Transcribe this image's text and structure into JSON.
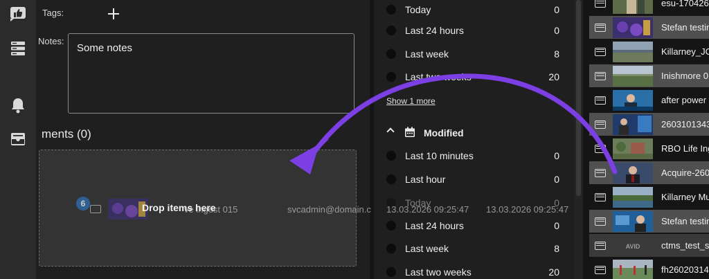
{
  "details": {
    "tags_label": "Tags:",
    "notes_label": "Notes:",
    "notes_value": "Some notes",
    "attachments_title": "ments (0)",
    "drop_label": "Drop items here"
  },
  "filters": {
    "group1": [
      {
        "label": "Today",
        "count": "0"
      },
      {
        "label": "Last 24 hours",
        "count": "0"
      },
      {
        "label": "Last week",
        "count": "8"
      },
      {
        "label": "Last two weeks",
        "count": "20"
      }
    ],
    "show_more": "Show 1 more",
    "modified_title": "Modified",
    "group2": [
      {
        "label": "Last 10 minutes",
        "count": "0"
      },
      {
        "label": "Last hour",
        "count": "0"
      },
      {
        "label": "Today",
        "count": "0"
      },
      {
        "label": "Last 24 hours",
        "count": "0"
      },
      {
        "label": "Last week",
        "count": "8"
      },
      {
        "label": "Last two weeks",
        "count": "20"
      }
    ]
  },
  "assets": [
    {
      "name": "esu-170426"
    },
    {
      "name": "Stefan testin"
    },
    {
      "name": "Killarney_JC"
    },
    {
      "name": "Inishmore 0"
    },
    {
      "name": "after power"
    },
    {
      "name": "2603101343"
    },
    {
      "name": "RBO Life Ing"
    },
    {
      "name": "Acquire-260"
    },
    {
      "name": "Killarney Mu"
    },
    {
      "name": "Stefan testin"
    },
    {
      "name": "ctms_test_s"
    },
    {
      "name": "fh26020314"
    }
  ],
  "ghost": {
    "count": "6",
    "name": "ve ingest 015",
    "user": "svcadmin@domain.c",
    "created": "13.03.2026 09:25:47",
    "modified": "13.03.2026 09:25:47"
  },
  "colors": {
    "accent_arrow": "#7b3fe4",
    "badge": "#2f6fb2",
    "panel_bg": "#1f1f1f",
    "rail_bg": "#2b2b2b"
  }
}
